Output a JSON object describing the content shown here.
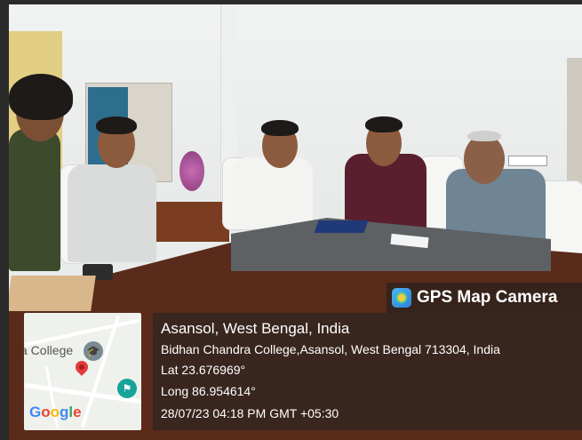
{
  "camera_app": {
    "name": "GPS Map Camera",
    "icon": "gps-map-camera-icon"
  },
  "location": {
    "title": "Asansol, West Bengal, India",
    "address": "Bidhan Chandra College,Asansol, West Bengal 713304, India",
    "lat": "Lat 23.676969°",
    "long": "Long 86.954614°",
    "datetime": "28/07/23 04:18 PM GMT +05:30"
  },
  "map": {
    "place_label": "a College",
    "logo": [
      "G",
      "o",
      "o",
      "g",
      "l",
      "e"
    ],
    "pin_icon": "map-pin-icon",
    "place_icon": "graduation-cap-icon",
    "poi_icon": "landmark-icon"
  },
  "colors": {
    "overlay": "#232323",
    "pin": "#e23b3b",
    "poi": "#15a39a"
  }
}
